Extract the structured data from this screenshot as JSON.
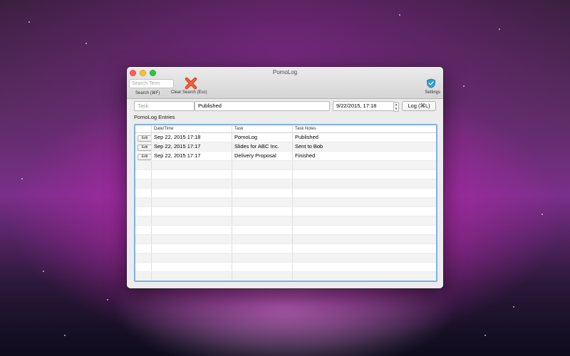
{
  "window": {
    "title": "PomoLog"
  },
  "toolbar": {
    "search_placeholder": "Search Term",
    "search_label": "Search (⌘F)",
    "clear_label": "Clear Search (Esc)",
    "settings_label": "Settings"
  },
  "entry_form": {
    "task_placeholder": "Task",
    "notes_value": "Published",
    "datetime_value": "9/22/2015, 17:18",
    "log_button": "Log (⌘L)"
  },
  "section_label": "PomoLog Entries",
  "table": {
    "columns": [
      "",
      "Date/Time",
      "Task",
      "Task Notes"
    ],
    "edit_label": "Edit",
    "rows": [
      {
        "datetime": "Sep 22, 2015 17:18",
        "task": "PomoLog",
        "notes": "Published"
      },
      {
        "datetime": "Sep 22, 2015 17:17",
        "task": "Slides for ABC Inc.",
        "notes": "Sent to Bob"
      },
      {
        "datetime": "Sep 22, 2015 17:17",
        "task": "Delivery Proposal",
        "notes": "Finished"
      }
    ]
  },
  "colors": {
    "accent": "#7fb2e6",
    "close": "#fc5f57",
    "minimize": "#fdbc2e",
    "zoom": "#28c840"
  }
}
